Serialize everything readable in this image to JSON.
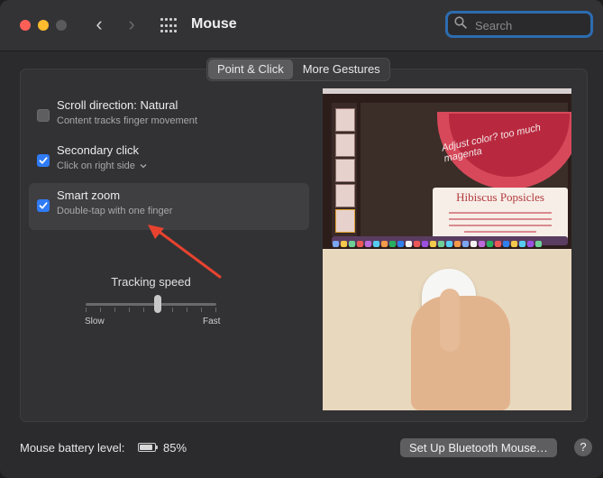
{
  "window": {
    "title": "Mouse"
  },
  "search": {
    "placeholder": "Search"
  },
  "tabs": [
    {
      "label": "Point & Click",
      "active": true
    },
    {
      "label": "More Gestures",
      "active": false
    }
  ],
  "options": [
    {
      "title": "Scroll direction: Natural",
      "subtitle": "Content tracks finger movement",
      "checked": false
    },
    {
      "title": "Secondary click",
      "subtitle": "Click on right side",
      "checked": true,
      "has_dropdown": true
    },
    {
      "title": "Smart zoom",
      "subtitle": "Double-tap with one finger",
      "checked": true,
      "highlighted": true
    }
  ],
  "tracking": {
    "label": "Tracking speed",
    "min_label": "Slow",
    "max_label": "Fast",
    "value_fraction": 0.55
  },
  "preview": {
    "slide_title": "Hibiscus Popsicles",
    "annotation": "Adjust color? too much magenta"
  },
  "footer": {
    "battery_label": "Mouse battery level:",
    "battery_percent": "85%",
    "battery_level": 0.85,
    "bluetooth_button": "Set Up Bluetooth Mouse…",
    "help": "?"
  },
  "colors": {
    "accent": "#2f7bf6",
    "arrow": "#e8432f"
  }
}
